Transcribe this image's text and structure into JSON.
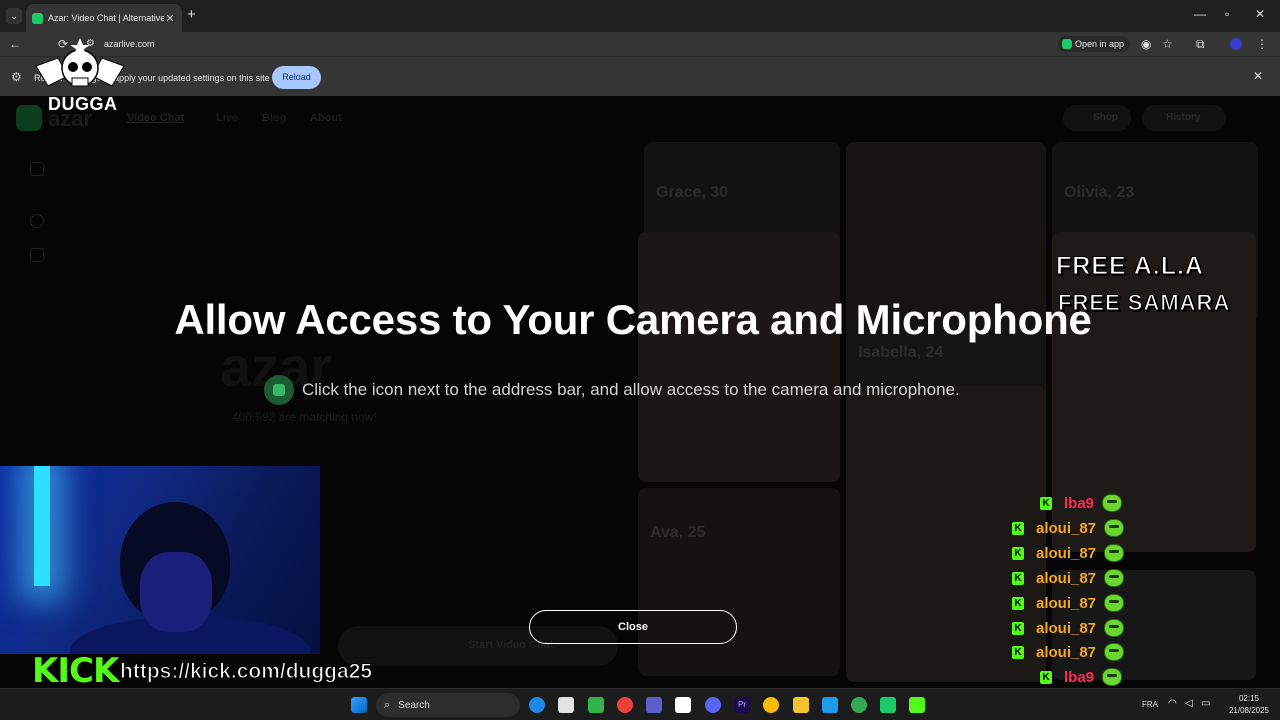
{
  "browser": {
    "tab_title": "Azar: Video Chat | Alternative t",
    "url": "azarlive.com",
    "open_in_app": "Open in app",
    "new_tab_symbol": "+",
    "tab_close": "✕"
  },
  "infobar": {
    "message": "Reload this page to apply your updated settings on this site",
    "reload_label": "Reload"
  },
  "site": {
    "logo": "azar",
    "nav": [
      "Video Chat",
      "Live",
      "Blog",
      "About"
    ],
    "shop": "Shop",
    "history": "History",
    "bg_logo": "azar",
    "matching_now": "400,592 are matching now!",
    "start_video_chat": "Start Video Chat",
    "profiles": [
      {
        "name": "Grace, 30"
      },
      {
        "name": "Olivia, 23"
      },
      {
        "name": "Isabella, 24"
      },
      {
        "name": "Ava, 25"
      }
    ]
  },
  "modal": {
    "title": "Allow Access to Your Camera and Microphone",
    "hint": "Click the icon next to the address bar, and allow access to the camera and microphone.",
    "close_label": "Close"
  },
  "stream": {
    "watermark": "DUGGA",
    "kick_logo": "KICK",
    "kick_url": "https://kick.com/dugga25",
    "free_1": "FREE A.L.A",
    "free_2": "FREE SAMARA",
    "chat": [
      {
        "name": "lba9",
        "color": "#ff2d55"
      },
      {
        "name": "aloui_87",
        "color": "#f5a623"
      },
      {
        "name": "aloui_87",
        "color": "#f5a623"
      },
      {
        "name": "aloui_87",
        "color": "#f5a623"
      },
      {
        "name": "aloui_87",
        "color": "#f5a623"
      },
      {
        "name": "aloui_87",
        "color": "#f5a623"
      },
      {
        "name": "aloui_87",
        "color": "#f5a623"
      },
      {
        "name": "lba9",
        "color": "#ff2d55"
      },
      {
        "name": "lba9",
        "color": "#ff2d55"
      }
    ]
  },
  "taskbar": {
    "search": "Search",
    "lang": "FRA",
    "time": "02:15",
    "date": "21/08/2025"
  },
  "colors": {
    "accent_green": "#53fc18",
    "reload_bg": "#a8c7fa"
  }
}
